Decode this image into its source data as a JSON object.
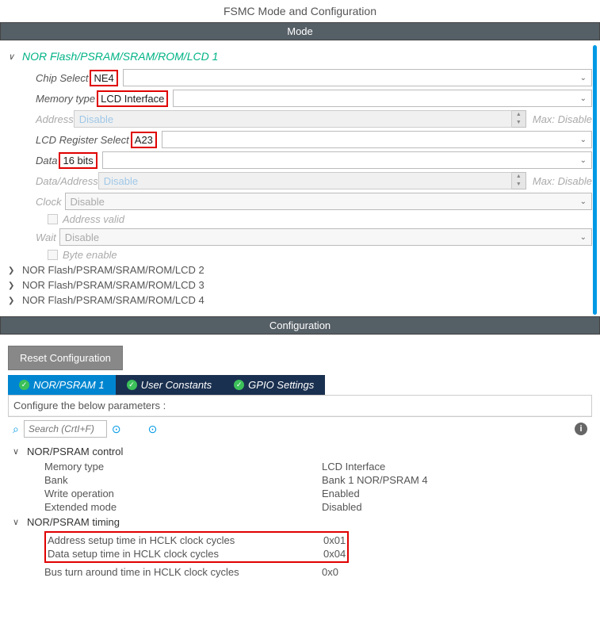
{
  "title": "FSMC Mode and Configuration",
  "mode_header": "Mode",
  "section1": {
    "title": "NOR Flash/PSRAM/SRAM/ROM/LCD 1",
    "rows": {
      "chip_select_lbl": "Chip Select",
      "chip_select_val": "NE4",
      "memory_type_lbl": "Memory type",
      "memory_type_val": "LCD Interface",
      "address_lbl": "Address",
      "address_val": "Disable",
      "address_max": "Max: Disable",
      "lcd_reg_lbl": "LCD Register Select",
      "lcd_reg_val": "A23",
      "data_lbl": "Data",
      "data_val": "16 bits",
      "data_addr_lbl": "Data/Address",
      "data_addr_val": "Disable",
      "data_addr_max": "Max: Disable",
      "clock_lbl": "Clock",
      "clock_val": "Disable",
      "addr_valid_lbl": "Address valid",
      "wait_lbl": "Wait",
      "wait_val": "Disable",
      "byte_enable_lbl": "Byte enable"
    }
  },
  "collapsed": [
    "NOR Flash/PSRAM/SRAM/ROM/LCD 2",
    "NOR Flash/PSRAM/SRAM/ROM/LCD 3",
    "NOR Flash/PSRAM/SRAM/ROM/LCD 4"
  ],
  "config_header": "Configuration",
  "reset_btn": "Reset Configuration",
  "tabs": {
    "t1": "NOR/PSRAM 1",
    "t2": "User Constants",
    "t3": "GPIO Settings"
  },
  "cfg_prompt": "Configure the below parameters :",
  "search_placeholder": "Search (CrtI+F)",
  "sections": {
    "control": {
      "title": "NOR/PSRAM control",
      "r1k": "Memory type",
      "r1v": "LCD Interface",
      "r2k": "Bank",
      "r2v": "Bank 1 NOR/PSRAM 4",
      "r3k": "Write operation",
      "r3v": "Enabled",
      "r4k": "Extended mode",
      "r4v": "Disabled"
    },
    "timing": {
      "title": "NOR/PSRAM timing",
      "r1k": "Address setup time in HCLK clock cycles",
      "r1v": "0x01",
      "r2k": "Data setup time in HCLK clock cycles",
      "r2v": "0x04",
      "r3k": "Bus turn around time in HCLK clock cycles",
      "r3v": "0x0"
    }
  }
}
